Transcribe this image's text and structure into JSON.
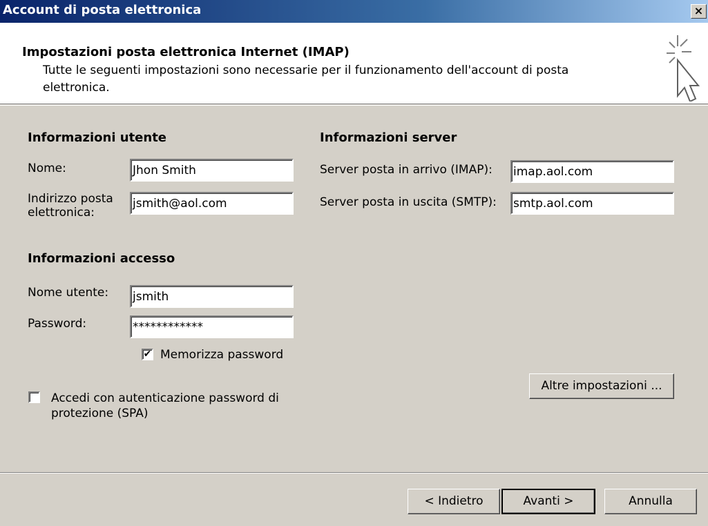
{
  "window": {
    "title": "Account di posta elettronica",
    "close_label": "×"
  },
  "header": {
    "heading": "Impostazioni posta elettronica Internet (IMAP)",
    "description": "Tutte le seguenti impostazioni sono necessarie per il funzionamento dell'account di posta elettronica."
  },
  "user_info": {
    "section_label": "Informazioni utente",
    "name_label": "Nome:",
    "name_value": "Jhon Smith",
    "email_label": "Indirizzo posta elettronica:",
    "email_value": "jsmith@aol.com"
  },
  "server_info": {
    "section_label": "Informazioni server",
    "incoming_label": "Server posta in arrivo (IMAP):",
    "incoming_value": "imap.aol.com",
    "outgoing_label": "Server posta in uscita (SMTP):",
    "outgoing_value": "smtp.aol.com"
  },
  "login_info": {
    "section_label": "Informazioni accesso",
    "username_label": "Nome utente:",
    "username_value": "jsmith",
    "password_label": "Password:",
    "password_value": "************",
    "remember_label": "Memorizza password",
    "remember_checked": true,
    "spa_label": "Accedi con autenticazione password di protezione (SPA)",
    "spa_checked": false
  },
  "buttons": {
    "more_settings": "Altre impostazioni ...",
    "back": "< Indietro",
    "next": "Avanti >",
    "cancel": "Annulla"
  },
  "colors": {
    "dialog_bg": "#d4d0c8",
    "titlebar_start": "#0a246a",
    "titlebar_end": "#a6caf0"
  },
  "icons": {
    "wizard": "cursor-sparkle-icon"
  }
}
